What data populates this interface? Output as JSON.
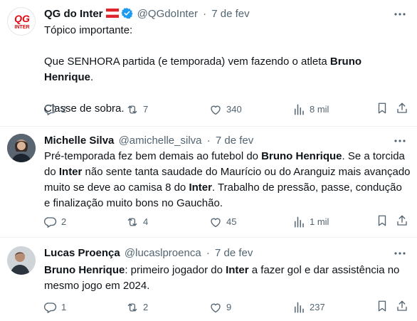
{
  "tweets": [
    {
      "author": {
        "name": "QG do Inter",
        "handle": "@QGdoInter",
        "date": "7 de fev",
        "avatar_text_top": "QG",
        "avatar_text_bottom": "INTER",
        "verified": true,
        "flag": "austria-flag"
      },
      "paragraphs": [
        [
          "Tópico importante:"
        ],
        [
          "Que SENHORA partida (e temporada) vem fazendo o atleta ",
          {
            "b": "Bruno Henrique"
          },
          "."
        ],
        [
          "Classe de sobra."
        ]
      ],
      "stats": {
        "replies": "2",
        "reposts": "7",
        "likes": "340",
        "views": "8 mil"
      }
    },
    {
      "author": {
        "name": "Michelle Silva",
        "handle": "@amichelle_silva",
        "date": "7 de fev"
      },
      "paragraphs": [
        [
          "Pré-temporada fez bem demais ao futebol do ",
          {
            "b": "Bruno Henrique"
          },
          ". Se a torcida do ",
          {
            "b": "Inter"
          },
          " não sente tanta saudade do Maurício ou do Aranguiz mais avançado muito se deve ao camisa 8 do ",
          {
            "b": "Inter"
          },
          ". Trabalho de pressão, passe, condução e finalização muito bons no Gauchão."
        ]
      ],
      "stats": {
        "replies": "2",
        "reposts": "4",
        "likes": "45",
        "views": "1 mil"
      }
    },
    {
      "author": {
        "name": "Lucas Proença",
        "handle": "@lucaslproenca",
        "date": "7 de fev"
      },
      "paragraphs": [
        [
          {
            "b": "Bruno Henrique"
          },
          ": primeiro jogador do ",
          {
            "b": "Inter"
          },
          " a fazer gol e dar assistência no mesmo jogo em 2024."
        ]
      ],
      "stats": {
        "replies": "1",
        "reposts": "2",
        "likes": "9",
        "views": "237"
      }
    }
  ],
  "separator": "·",
  "colors": {
    "text": "#0f1419",
    "muted": "#536471",
    "verified": "#1d9bf0",
    "inter_red": "#e5050f",
    "divider": "#eff3f4"
  }
}
